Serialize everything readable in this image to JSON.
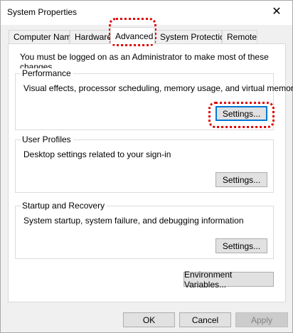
{
  "window": {
    "title": "System Properties",
    "close_glyph": "✕"
  },
  "tabs": [
    {
      "label": "Computer Name"
    },
    {
      "label": "Hardware"
    },
    {
      "label": "Advanced"
    },
    {
      "label": "System Protection"
    },
    {
      "label": "Remote"
    }
  ],
  "active_tab": "Advanced",
  "admin_message": "You must be logged on as an Administrator to make most of these changes.",
  "performance": {
    "title": "Performance",
    "description": "Visual effects, processor scheduling, memory usage, and virtual memory",
    "settings_label": "Settings..."
  },
  "user_profiles": {
    "title": "User Profiles",
    "description": "Desktop settings related to your sign-in",
    "settings_label": "Settings..."
  },
  "startup_recovery": {
    "title": "Startup and Recovery",
    "description": "System startup, system failure, and debugging information",
    "settings_label": "Settings..."
  },
  "environment_variables_label": "Environment Variables...",
  "footer": {
    "ok_label": "OK",
    "cancel_label": "Cancel",
    "apply_label": "Apply"
  },
  "colors": {
    "highlight": "#e00000",
    "focus": "#0078d7"
  }
}
